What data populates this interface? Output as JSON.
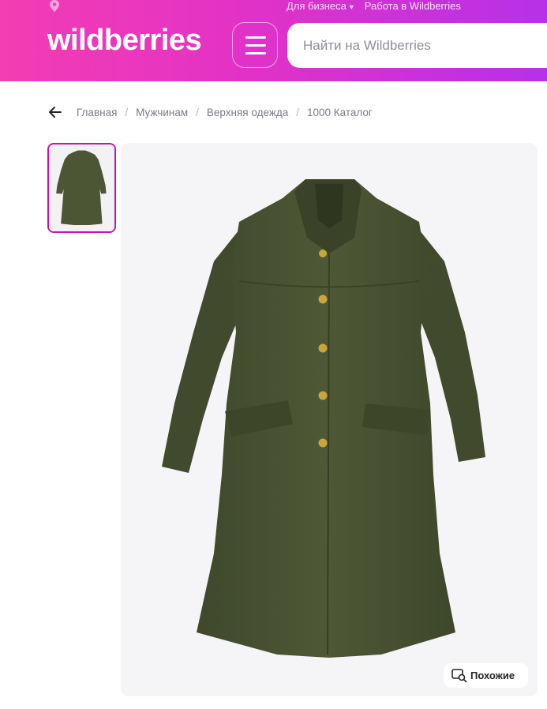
{
  "header": {
    "top_links": {
      "business": "Для бизнеса",
      "work": "Работа в Wildberries"
    },
    "logo": "wildberries",
    "search": {
      "placeholder": "Найти на Wildberries",
      "value": ""
    }
  },
  "breadcrumb": {
    "items": [
      "Главная",
      "Мужчинам",
      "Верхняя одежда",
      "1000 Каталог"
    ],
    "separator": "/"
  },
  "gallery": {
    "similar_label": "Похожие"
  },
  "colors": {
    "brand_start": "#f33db2",
    "brand_end": "#b631e9",
    "thumb_border": "#cb11ab"
  },
  "icons": [
    "location-icon",
    "chevron-down-icon",
    "menu-icon",
    "back-arrow-icon",
    "similar-search-icon"
  ]
}
